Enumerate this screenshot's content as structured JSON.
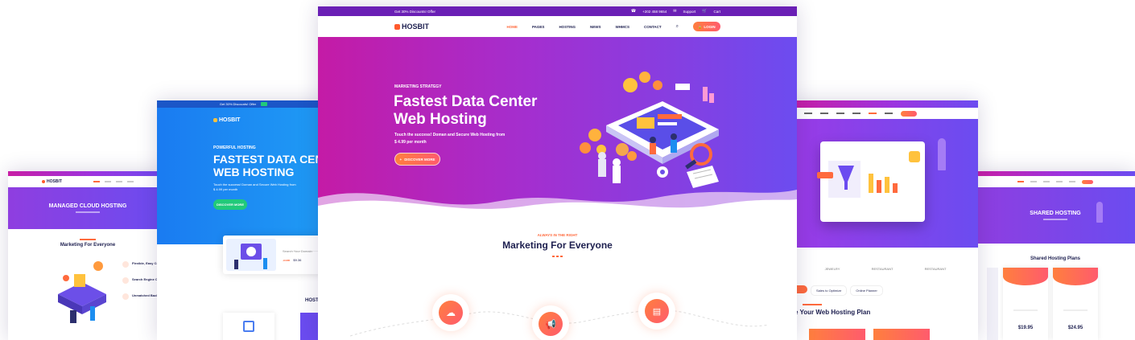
{
  "colors": {
    "accent_orange": "#ff6a3d",
    "purple_start": "#c81ea5",
    "purple_end": "#6b4cf0",
    "blue": "#1a7bf1",
    "navy": "#1d1f4f",
    "green": "#21c97a"
  },
  "center": {
    "topbar": {
      "offer": "Get 30% Discounts! Offer",
      "phone": "+202 458 9654",
      "support": "Support",
      "cart": "Cart"
    },
    "logo": "HOSBIT",
    "nav": [
      "HOME",
      "PAGES",
      "HOSTING",
      "NEWS",
      "WHMCS",
      "CONTACT"
    ],
    "login": "LOGIN",
    "hero": {
      "eyebrow": "MARKETING STRATEGY",
      "title_line1": "Fastest Data Center",
      "title_line2": "Web Hosting",
      "subtitle_line1": "Touch the success! Doman and Secure Web Hosting from",
      "subtitle_line2": "$ 4.99 per month",
      "cta": "DISCOVER MORE"
    },
    "section": {
      "eyebrow": "ALWAYS IN THE RIGHT",
      "title": "Marketing For Everyone"
    }
  },
  "blue_frame": {
    "topbar": "Get 30% Discounts! Offer",
    "logo": "HOSBIT",
    "eyebrow": "POWERFUL HOSTING",
    "title_line1": "FASTEST DATA CEN",
    "title_line2": "WEB HOSTING",
    "subtitle_line1": "Touch the success! Doman and Secure Web Hosting from",
    "subtitle_line2": "$ 4.99 per month",
    "cta": "DISCOVER MORE",
    "search_placeholder": "Search Your Domain",
    "domain_ext": ".com",
    "domain_price": "$9.36",
    "section_title": "HOST"
  },
  "left_frame": {
    "logo": "HOSBIT",
    "hero_title": "MANAGED CLOUD HOSTING",
    "section_title": "Marketing For Everyone",
    "features": [
      "Flexible, Easy Con",
      "Search Engine Opt",
      "Unmatched Backlin"
    ]
  },
  "right_frame": {
    "logos": [
      "JEWELRY",
      "RESTAURANT",
      "RESTAURANT"
    ],
    "tabs": [
      "Sales to Optimize",
      "Online Planner"
    ],
    "section_title": "e Your Web Hosting Plan"
  },
  "far_right_frame": {
    "hero_title": "SHARED HOSTING",
    "section_title": "Shared Hosting Plans",
    "prices": [
      "$19.95",
      "$24.95"
    ]
  }
}
